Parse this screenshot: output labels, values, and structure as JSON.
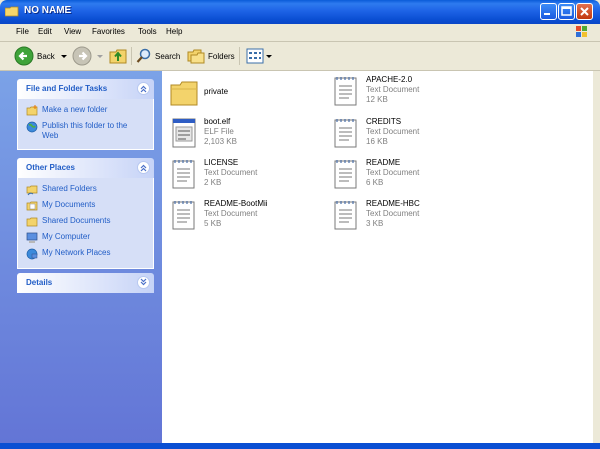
{
  "window": {
    "title": "NO NAME"
  },
  "menu": [
    "File",
    "Edit",
    "View",
    "Favorites",
    "Tools",
    "Help"
  ],
  "toolbar": {
    "back": "Back",
    "search": "Search",
    "folders": "Folders"
  },
  "panels": {
    "tasks": {
      "title": "File and Folder Tasks",
      "items": [
        "Make a new folder",
        "Publish this folder to the Web"
      ]
    },
    "places": {
      "title": "Other Places",
      "items": [
        "Shared Folders",
        "My Documents",
        "Shared Documents",
        "My Computer",
        "My Network Places"
      ]
    },
    "details": {
      "title": "Details"
    }
  },
  "files": [
    {
      "name": "private",
      "type": "",
      "size": "",
      "icon": "folder-icon"
    },
    {
      "name": "APACHE-2.0",
      "type": "Text Document",
      "size": "12 KB",
      "icon": "text-document-icon"
    },
    {
      "name": "boot.elf",
      "type": "ELF File",
      "size": "2,103 KB",
      "icon": "elf-file-icon"
    },
    {
      "name": "CREDITS",
      "type": "Text Document",
      "size": "16 KB",
      "icon": "text-document-icon"
    },
    {
      "name": "LICENSE",
      "type": "Text Document",
      "size": "2 KB",
      "icon": "text-document-icon"
    },
    {
      "name": "README",
      "type": "Text Document",
      "size": "6 KB",
      "icon": "text-document-icon"
    },
    {
      "name": "README-BootMii",
      "type": "Text Document",
      "size": "5 KB",
      "icon": "text-document-icon"
    },
    {
      "name": "README-HBC",
      "type": "Text Document",
      "size": "3 KB",
      "icon": "text-document-icon"
    }
  ]
}
